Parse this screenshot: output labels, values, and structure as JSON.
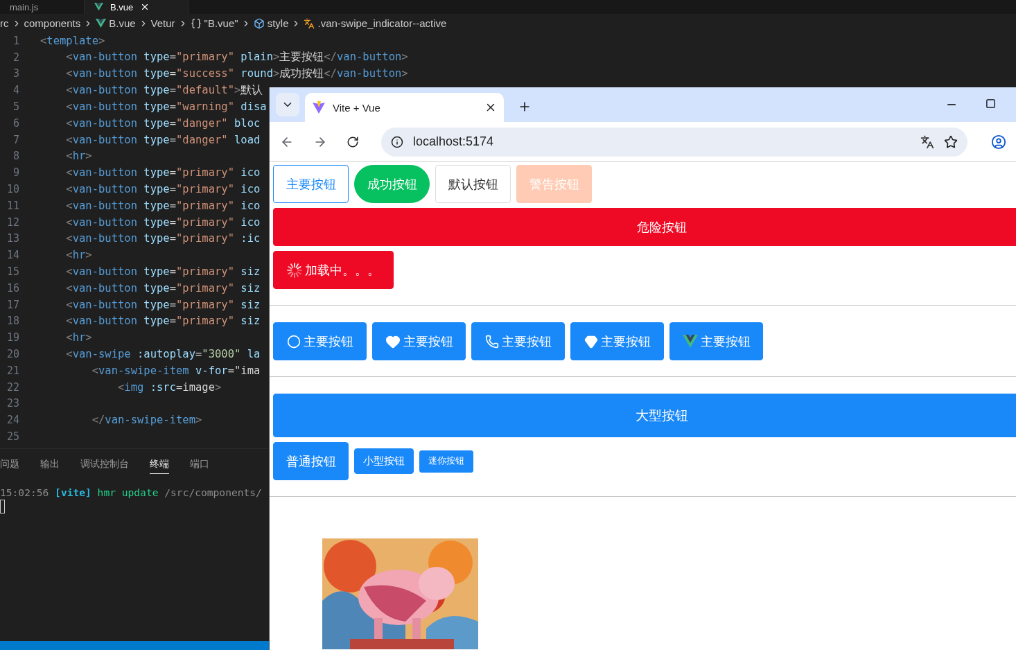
{
  "editor": {
    "tabs": [
      {
        "label": "main.js",
        "selected": false
      },
      {
        "label": "B.vue",
        "selected": true
      }
    ],
    "breadcrumb": [
      "rc",
      "components",
      "B.vue",
      "Vetur",
      "\"B.vue\"",
      "style",
      ".van-swipe_indicator--active"
    ],
    "lines": [
      {
        "number": "1",
        "tokens": [
          {
            "kind": "bracket",
            "text": "<"
          },
          {
            "kind": "tag",
            "text": "template"
          },
          {
            "kind": "bracket",
            "text": ">"
          }
        ]
      },
      {
        "number": "2",
        "tokens": [
          {
            "kind": "bracket",
            "text": "    <"
          },
          {
            "kind": "tag",
            "text": "van-button"
          },
          {
            "kind": "attr",
            "text": " type"
          },
          {
            "kind": "text",
            "text": "="
          },
          {
            "kind": "string",
            "text": "\"primary\""
          },
          {
            "kind": "attr",
            "text": " plain"
          },
          {
            "kind": "bracket",
            "text": ">"
          },
          {
            "kind": "text",
            "text": "主要按钮"
          },
          {
            "kind": "bracket",
            "text": "</"
          },
          {
            "kind": "tag",
            "text": "van-button"
          },
          {
            "kind": "bracket",
            "text": ">"
          }
        ]
      },
      {
        "number": "3",
        "tokens": [
          {
            "kind": "bracket",
            "text": "    <"
          },
          {
            "kind": "tag",
            "text": "van-button"
          },
          {
            "kind": "attr",
            "text": " type"
          },
          {
            "kind": "text",
            "text": "="
          },
          {
            "kind": "string",
            "text": "\"success\""
          },
          {
            "kind": "attr",
            "text": " round"
          },
          {
            "kind": "bracket",
            "text": ">"
          },
          {
            "kind": "text",
            "text": "成功按钮"
          },
          {
            "kind": "bracket",
            "text": "</"
          },
          {
            "kind": "tag",
            "text": "van-button"
          },
          {
            "kind": "bracket",
            "text": ">"
          }
        ]
      },
      {
        "number": "4",
        "tokens": [
          {
            "kind": "bracket",
            "text": "    <"
          },
          {
            "kind": "tag",
            "text": "van-button"
          },
          {
            "kind": "attr",
            "text": " type"
          },
          {
            "kind": "text",
            "text": "="
          },
          {
            "kind": "string",
            "text": "\"default\""
          },
          {
            "kind": "bracket",
            "text": ">"
          },
          {
            "kind": "text",
            "text": "默认"
          }
        ]
      },
      {
        "number": "5",
        "tokens": [
          {
            "kind": "bracket",
            "text": "    <"
          },
          {
            "kind": "tag",
            "text": "van-button"
          },
          {
            "kind": "attr",
            "text": " type"
          },
          {
            "kind": "text",
            "text": "="
          },
          {
            "kind": "string",
            "text": "\"warning\""
          },
          {
            "kind": "attr",
            "text": " disa"
          }
        ]
      },
      {
        "number": "6",
        "tokens": [
          {
            "kind": "bracket",
            "text": "    <"
          },
          {
            "kind": "tag",
            "text": "van-button"
          },
          {
            "kind": "attr",
            "text": " type"
          },
          {
            "kind": "text",
            "text": "="
          },
          {
            "kind": "string",
            "text": "\"danger\""
          },
          {
            "kind": "attr",
            "text": " bloc"
          }
        ]
      },
      {
        "number": "7",
        "tokens": [
          {
            "kind": "bracket",
            "text": "    <"
          },
          {
            "kind": "tag",
            "text": "van-button"
          },
          {
            "kind": "attr",
            "text": " type"
          },
          {
            "kind": "text",
            "text": "="
          },
          {
            "kind": "string",
            "text": "\"danger\""
          },
          {
            "kind": "attr",
            "text": " load"
          }
        ]
      },
      {
        "number": "8",
        "tokens": [
          {
            "kind": "bracket",
            "text": "    <"
          },
          {
            "kind": "tag",
            "text": "hr"
          },
          {
            "kind": "bracket",
            "text": ">"
          }
        ]
      },
      {
        "number": "9",
        "tokens": [
          {
            "kind": "bracket",
            "text": "    <"
          },
          {
            "kind": "tag",
            "text": "van-button"
          },
          {
            "kind": "attr",
            "text": " type"
          },
          {
            "kind": "text",
            "text": "="
          },
          {
            "kind": "string",
            "text": "\"primary\""
          },
          {
            "kind": "attr",
            "text": " ico"
          }
        ]
      },
      {
        "number": "10",
        "tokens": [
          {
            "kind": "bracket",
            "text": "    <"
          },
          {
            "kind": "tag",
            "text": "van-button"
          },
          {
            "kind": "attr",
            "text": " type"
          },
          {
            "kind": "text",
            "text": "="
          },
          {
            "kind": "string",
            "text": "\"primary\""
          },
          {
            "kind": "attr",
            "text": " ico"
          }
        ]
      },
      {
        "number": "11",
        "tokens": [
          {
            "kind": "bracket",
            "text": "    <"
          },
          {
            "kind": "tag",
            "text": "van-button"
          },
          {
            "kind": "attr",
            "text": " type"
          },
          {
            "kind": "text",
            "text": "="
          },
          {
            "kind": "string",
            "text": "\"primary\""
          },
          {
            "kind": "attr",
            "text": " ico"
          }
        ]
      },
      {
        "number": "12",
        "tokens": [
          {
            "kind": "bracket",
            "text": "    <"
          },
          {
            "kind": "tag",
            "text": "van-button"
          },
          {
            "kind": "attr",
            "text": " type"
          },
          {
            "kind": "text",
            "text": "="
          },
          {
            "kind": "string",
            "text": "\"primary\""
          },
          {
            "kind": "attr",
            "text": " ico"
          }
        ]
      },
      {
        "number": "13",
        "tokens": [
          {
            "kind": "bracket",
            "text": "    <"
          },
          {
            "kind": "tag",
            "text": "van-button"
          },
          {
            "kind": "attr",
            "text": " type"
          },
          {
            "kind": "text",
            "text": "="
          },
          {
            "kind": "string",
            "text": "\"primary\""
          },
          {
            "kind": "attr",
            "text": " :ic"
          }
        ]
      },
      {
        "number": "14",
        "tokens": [
          {
            "kind": "bracket",
            "text": "    <"
          },
          {
            "kind": "tag",
            "text": "hr"
          },
          {
            "kind": "bracket",
            "text": ">"
          }
        ]
      },
      {
        "number": "15",
        "tokens": [
          {
            "kind": "bracket",
            "text": "    <"
          },
          {
            "kind": "tag",
            "text": "van-button"
          },
          {
            "kind": "attr",
            "text": " type"
          },
          {
            "kind": "text",
            "text": "="
          },
          {
            "kind": "string",
            "text": "\"primary\""
          },
          {
            "kind": "attr",
            "text": " siz"
          }
        ]
      },
      {
        "number": "16",
        "tokens": [
          {
            "kind": "bracket",
            "text": "    <"
          },
          {
            "kind": "tag",
            "text": "van-button"
          },
          {
            "kind": "attr",
            "text": " type"
          },
          {
            "kind": "text",
            "text": "="
          },
          {
            "kind": "string",
            "text": "\"primary\""
          },
          {
            "kind": "attr",
            "text": " siz"
          }
        ]
      },
      {
        "number": "17",
        "tokens": [
          {
            "kind": "bracket",
            "text": "    <"
          },
          {
            "kind": "tag",
            "text": "van-button"
          },
          {
            "kind": "attr",
            "text": " type"
          },
          {
            "kind": "text",
            "text": "="
          },
          {
            "kind": "string",
            "text": "\"primary\""
          },
          {
            "kind": "attr",
            "text": " siz"
          }
        ]
      },
      {
        "number": "18",
        "tokens": [
          {
            "kind": "bracket",
            "text": "    <"
          },
          {
            "kind": "tag",
            "text": "van-button"
          },
          {
            "kind": "attr",
            "text": " type"
          },
          {
            "kind": "text",
            "text": "="
          },
          {
            "kind": "string",
            "text": "\"primary\""
          },
          {
            "kind": "attr",
            "text": " siz"
          }
        ]
      },
      {
        "number": "19",
        "tokens": [
          {
            "kind": "bracket",
            "text": "    <"
          },
          {
            "kind": "tag",
            "text": "hr"
          },
          {
            "kind": "bracket",
            "text": ">"
          }
        ]
      },
      {
        "number": "20",
        "tokens": [
          {
            "kind": "bracket",
            "text": "    <"
          },
          {
            "kind": "tag",
            "text": "van-swipe"
          },
          {
            "kind": "attr",
            "text": " :autoplay"
          },
          {
            "kind": "text",
            "text": "="
          },
          {
            "kind": "number",
            "text": "\"3000\""
          },
          {
            "kind": "attr",
            "text": " la"
          }
        ]
      },
      {
        "number": "21",
        "tokens": [
          {
            "kind": "bracket",
            "text": "        <"
          },
          {
            "kind": "tag",
            "text": "van-swipe-item"
          },
          {
            "kind": "attr",
            "text": " v-for"
          },
          {
            "kind": "text",
            "text": "=\"ima"
          }
        ]
      },
      {
        "number": "22",
        "tokens": [
          {
            "kind": "bracket",
            "text": "            <"
          },
          {
            "kind": "tag",
            "text": "img"
          },
          {
            "kind": "attr",
            "text": " :src"
          },
          {
            "kind": "text",
            "text": "=image"
          },
          {
            "kind": "bracket",
            "text": ">"
          }
        ]
      },
      {
        "number": "23"
      },
      {
        "number": "24",
        "tokens": [
          {
            "kind": "bracket",
            "text": "        </"
          },
          {
            "kind": "tag",
            "text": "van-swipe-item"
          },
          {
            "kind": "bracket",
            "text": ">"
          }
        ]
      },
      {
        "number": "25"
      }
    ],
    "panel_tabs": [
      {
        "label": "问题",
        "selected": false
      },
      {
        "label": "输出",
        "selected": false
      },
      {
        "label": "调试控制台",
        "selected": false
      },
      {
        "label": "终端",
        "selected": true
      },
      {
        "label": "端口",
        "selected": false
      }
    ],
    "terminal": [
      {
        "kind": "time",
        "text": "15:02:56"
      },
      {
        "kind": "tag",
        "text": "[vite]"
      },
      {
        "kind": "action",
        "text": "hmr update"
      },
      {
        "kind": "path",
        "text": "/src/components/"
      }
    ]
  },
  "browser": {
    "tab_title": "Vite + Vue",
    "url": "localhost:5174",
    "rows": [
      {
        "kind": "buttons",
        "buttons": [
          {
            "label": "主要按钮",
            "kind": "plain",
            "color": "#1989fa"
          },
          {
            "label": "成功按钮",
            "kind": "round",
            "color": "#07c160"
          },
          {
            "label": "默认按钮",
            "kind": "normal",
            "color": "#ffffff"
          },
          {
            "label": "警告按钮",
            "kind": "disabled",
            "color": "#ffcbb4"
          }
        ]
      },
      {
        "kind": "buttons",
        "buttons": [
          {
            "label": "危险按钮",
            "kind": "block",
            "color": "#ee0a24"
          }
        ]
      },
      {
        "kind": "buttons",
        "buttons": [
          {
            "label": "加载中。。。",
            "kind": "loading",
            "color": "#ee0a24"
          }
        ]
      },
      {
        "kind": "rule"
      },
      {
        "kind": "buttons",
        "buttons": [
          {
            "label": "主要按钮",
            "kind": "icon",
            "color": "#1989fa"
          },
          {
            "label": "主要按钮",
            "kind": "icon",
            "color": "#1989fa"
          },
          {
            "label": "主要按钮",
            "kind": "icon",
            "color": "#1989fa"
          },
          {
            "label": "主要按钮",
            "kind": "icon",
            "color": "#1989fa"
          },
          {
            "label": "主要按钮",
            "kind": "icon",
            "color": "#1989fa"
          }
        ]
      },
      {
        "kind": "rule"
      },
      {
        "kind": "buttons",
        "buttons": [
          {
            "label": "大型按钮",
            "kind": "large",
            "color": "#1989fa"
          }
        ]
      },
      {
        "kind": "buttons",
        "buttons": [
          {
            "label": "普通按钮",
            "kind": "normal",
            "color": "#1989fa"
          },
          {
            "label": "小型按钮",
            "kind": "small",
            "color": "#1989fa"
          },
          {
            "label": "迷你按钮",
            "kind": "mini",
            "color": "#1989fa"
          }
        ]
      },
      {
        "kind": "rule"
      },
      {
        "kind": "picture"
      }
    ]
  }
}
